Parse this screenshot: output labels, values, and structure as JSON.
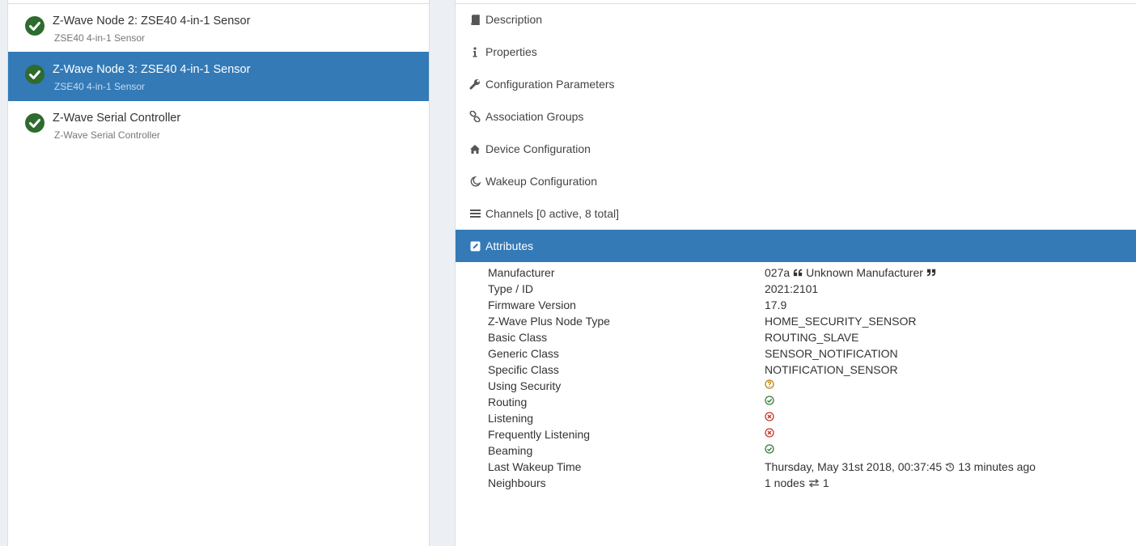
{
  "nodes": [
    {
      "title": "Z-Wave Node 2: ZSE40 4-in-1 Sensor",
      "subtitle": "ZSE40 4-in-1 Sensor",
      "active": false
    },
    {
      "title": "Z-Wave Node 3: ZSE40 4-in-1 Sensor",
      "subtitle": "ZSE40 4-in-1 Sensor",
      "active": true
    },
    {
      "title": "Z-Wave Serial Controller",
      "subtitle": "Z-Wave Serial Controller",
      "active": false
    }
  ],
  "menu": [
    {
      "label": "Description",
      "icon": "book-icon"
    },
    {
      "label": "Properties",
      "icon": "info-icon"
    },
    {
      "label": "Configuration Parameters",
      "icon": "wrench-icon"
    },
    {
      "label": "Association Groups",
      "icon": "link-icon"
    },
    {
      "label": "Device Configuration",
      "icon": "home-icon"
    },
    {
      "label": "Wakeup Configuration",
      "icon": "moon-icon"
    },
    {
      "label": "Channels [0 active, 8 total]",
      "icon": "list-icon"
    },
    {
      "label": "Attributes",
      "icon": "edit-icon",
      "active": true
    }
  ],
  "attributes": {
    "manufacturer": {
      "label": "Manufacturer",
      "code": "027a",
      "name": "Unknown Manufacturer"
    },
    "type_id": {
      "label": "Type / ID",
      "value": "2021:2101"
    },
    "firmware": {
      "label": "Firmware Version",
      "value": "17.9"
    },
    "plus_type": {
      "label": "Z-Wave Plus Node Type",
      "value": "HOME_SECURITY_SENSOR"
    },
    "basic_class": {
      "label": "Basic Class",
      "value": "ROUTING_SLAVE"
    },
    "generic_class": {
      "label": "Generic Class",
      "value": "SENSOR_NOTIFICATION"
    },
    "specific_class": {
      "label": "Specific Class",
      "value": "NOTIFICATION_SENSOR"
    },
    "security": {
      "label": "Using Security",
      "status": "unknown"
    },
    "routing": {
      "label": "Routing",
      "status": "yes"
    },
    "listening": {
      "label": "Listening",
      "status": "no"
    },
    "freq_listening": {
      "label": "Frequently Listening",
      "status": "no"
    },
    "beaming": {
      "label": "Beaming",
      "status": "yes"
    },
    "last_wakeup": {
      "label": "Last Wakeup Time",
      "value": "Thursday, May 31st 2018, 00:37:45",
      "ago": "13 minutes ago"
    },
    "neighbours": {
      "label": "Neighbours",
      "value": "1 nodes",
      "count": "1"
    }
  },
  "colors": {
    "accent": "#337ab7",
    "ok": "#3a7a3a",
    "error": "#c0392b",
    "unknown": "#b8860b"
  }
}
